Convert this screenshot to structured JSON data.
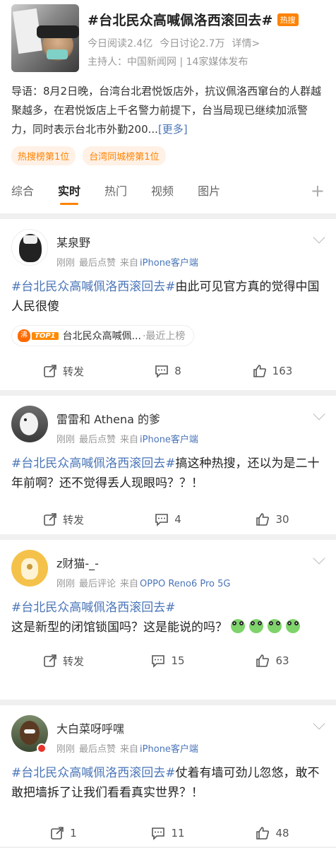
{
  "topic": {
    "title": "#台北民众高喊佩洛西滚回去#",
    "badge": "热搜",
    "reads": "今日阅读2.4亿",
    "discussions": "今日讨论2.7万",
    "detail_link": "详情>",
    "host": "主持人：中国新闻网 | 14家媒体发布",
    "intro_text": "导语：8月2日晚，台湾台北君悦饭店外，抗议佩洛西窜台的人群越聚越多，在君悦饭店上千名警力前提下，台当局现已继续加派警力，同时表示台北市外勤200...",
    "more_link": "[更多]",
    "tags": [
      "热搜榜第1位",
      "台湾同城榜第1位"
    ]
  },
  "tabs": [
    "综合",
    "实时",
    "热门",
    "视频",
    "图片"
  ],
  "active_tab": "实时",
  "colors": {
    "accent": "#ff8200",
    "link": "#4a75b8"
  },
  "posts": [
    {
      "username": "某泉野",
      "time": "刚刚",
      "activity": "最后点赞",
      "source_prefix": "来自",
      "source": "iPhone客户端",
      "hashtag": "#台北民众高喊佩洛西滚回去#",
      "text": "由此可见官方真的觉得中国人民很傻",
      "rank_chip": {
        "flame": "沸",
        "top": "TOP1",
        "label": "台北民众高喊佩...",
        "status": "·最近上榜"
      },
      "repost_label": "转发",
      "comments": "8",
      "likes": "163"
    },
    {
      "username": "雷雷和 Athena 的爹",
      "time": "刚刚",
      "activity": "最后点赞",
      "source_prefix": "来自",
      "source": "iPhone客户端",
      "hashtag": "#台北民众高喊佩洛西滚回去#",
      "text": "搞这种热搜，还以为是二十年前啊？还不觉得丢人现眼吗？？！",
      "repost_label": "转发",
      "comments": "4",
      "likes": "30"
    },
    {
      "username": "z财猫-_-",
      "time": "刚刚",
      "activity": "最后评论",
      "source_prefix": "来自",
      "source": "OPPO Reno6 Pro 5G",
      "hashtag": "#台北民众高喊佩洛西滚回去#",
      "text": "这是新型的闭馆锁国吗？这是能说的吗？",
      "repost_label": "转发",
      "comments": "15",
      "likes": "63"
    },
    {
      "username": "大白菜呀呼嘿",
      "time": "刚刚",
      "activity": "最后点赞",
      "source_prefix": "来自",
      "source": "iPhone客户端",
      "hashtag": "#台北民众高喊佩洛西滚回去#",
      "text": "仗着有墙可劲儿忽悠，敢不敢把墙拆了让我们看看真实世界？！",
      "reposts": "1",
      "comments": "11",
      "likes": "48"
    }
  ]
}
